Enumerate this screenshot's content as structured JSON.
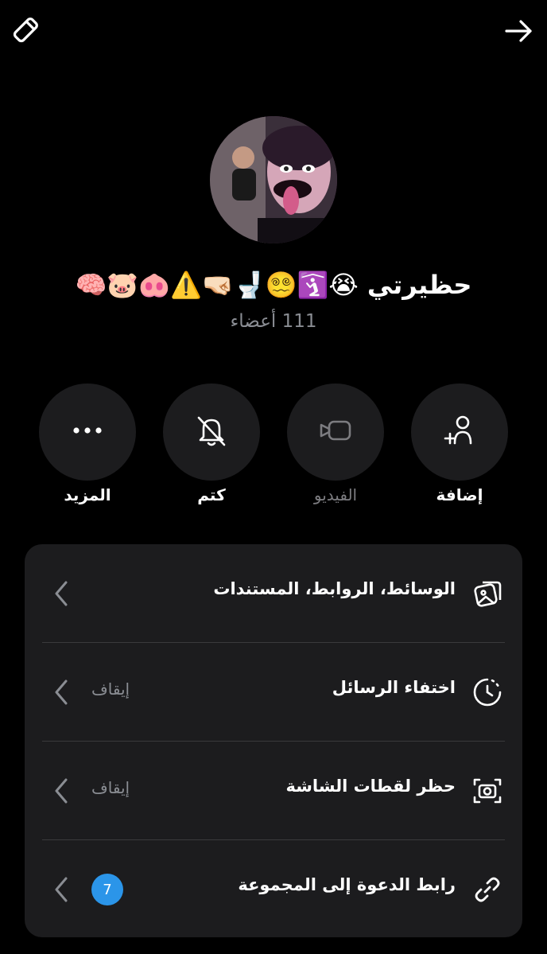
{
  "header": {
    "edit_icon": "pencil-icon",
    "back_icon": "arrow-right-icon"
  },
  "group": {
    "name": "حظيرتي 😭🛐😵‍💫🚽🤜🏻⚠️🐽🐷🧠",
    "member_count": "111 أعضاء"
  },
  "actions": [
    {
      "label": "إضافة",
      "icon": "add-person-icon"
    },
    {
      "label": "الفيديو",
      "icon": "video-camera-icon"
    },
    {
      "label": "كتم",
      "icon": "bell-off-icon"
    },
    {
      "label": "المزيد",
      "icon": "more-dots-icon"
    }
  ],
  "settings": [
    {
      "title": "الوسائط، الروابط، المستندات",
      "icon": "media-gallery-icon",
      "value": ""
    },
    {
      "title": "اختفاء الرسائل",
      "icon": "timer-icon",
      "value": "إيقاف"
    },
    {
      "title": "حظر لقطات الشاشة",
      "icon": "screenshot-camera-icon",
      "value": "إيقاف"
    },
    {
      "title": "رابط الدعوة إلى المجموعة",
      "icon": "link-icon",
      "badge": "7"
    }
  ],
  "colors": {
    "background": "#000000",
    "card": "#1c1c1e",
    "badge": "#2b95e9",
    "muted_text": "#8a8d93"
  }
}
